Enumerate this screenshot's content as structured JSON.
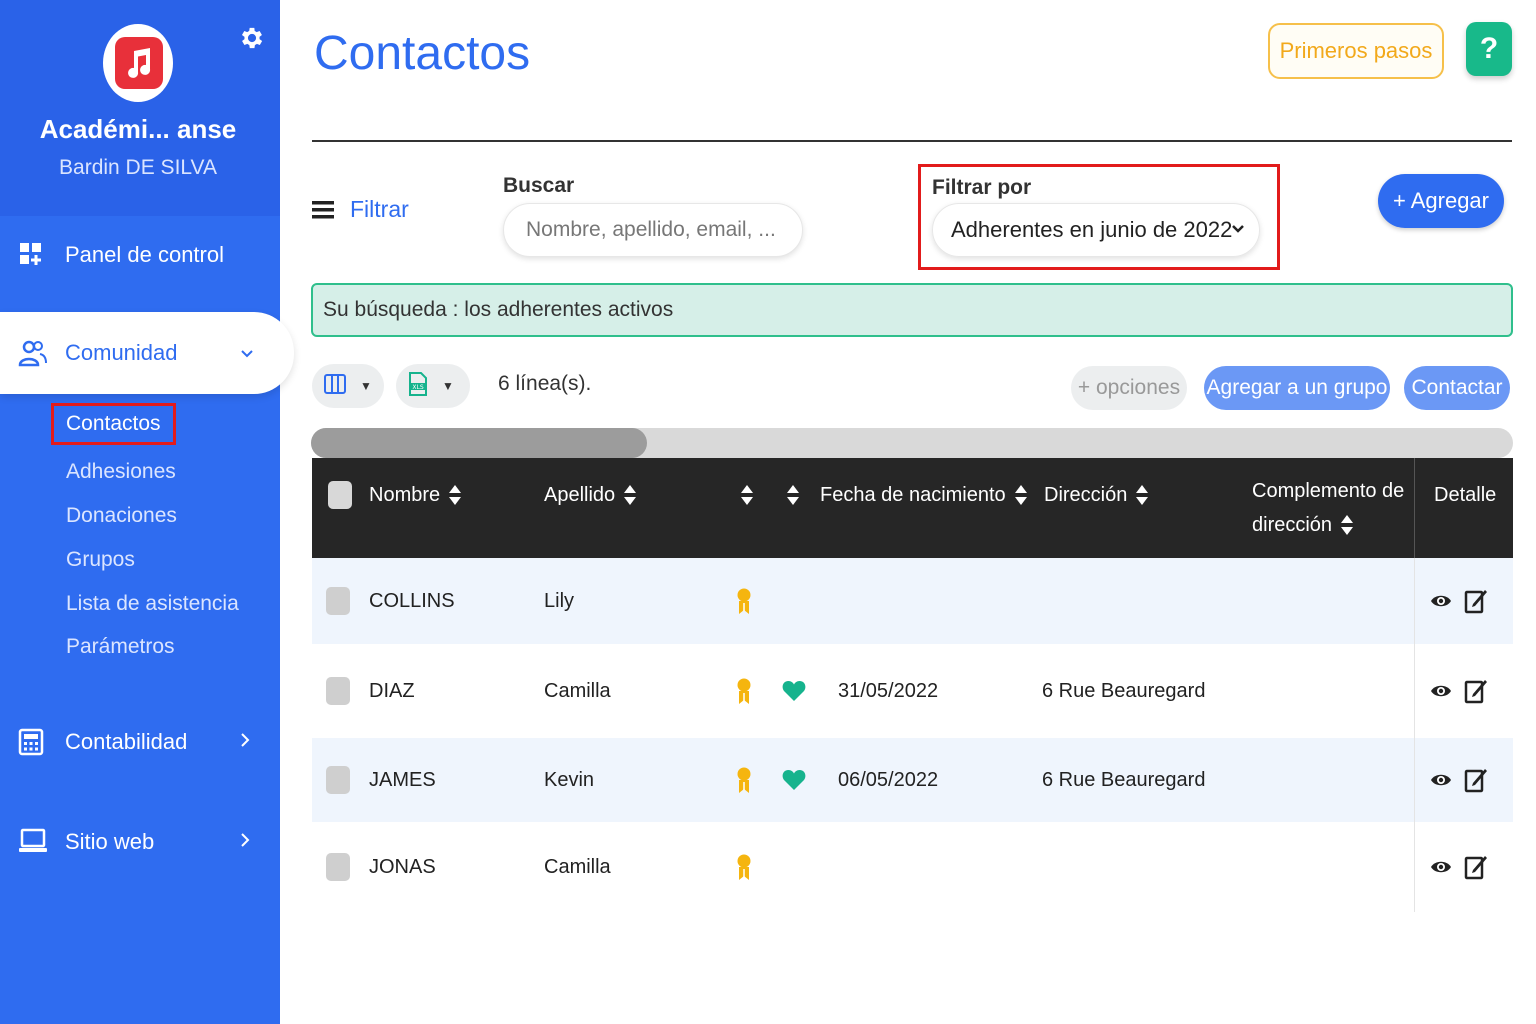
{
  "sidebar": {
    "org_name": "Académi... anse",
    "user_name": "Bardin DE SILVA",
    "nav": {
      "dashboard": "Panel de control",
      "community": "Comunidad",
      "accounting": "Contabilidad",
      "website": "Sitio web"
    },
    "community_items": [
      "Contactos",
      "Adhesiones",
      "Donaciones",
      "Grupos",
      "Lista de asistencia",
      "Parámetros"
    ]
  },
  "header": {
    "title": "Contactos",
    "primeros_pasos": "Primeros pasos",
    "help": "?"
  },
  "toolbar": {
    "filter_toggle": "Filtrar",
    "search_label": "Buscar",
    "search_placeholder": "Nombre, apellido, email, ...",
    "filter_label": "Filtrar por",
    "filter_value": "Adherentes en junio de 2022",
    "add_button": "+ Agregar"
  },
  "summary": "Su búsqueda : los adherentes activos",
  "actions": {
    "line_count": "6 línea(s).",
    "options": "+ opciones",
    "add_to_group": "Agregar a un grupo",
    "contact": "Contactar"
  },
  "table": {
    "headers": {
      "nombre": "Nombre",
      "apellido": "Apellido",
      "fecha": "Fecha de nacimiento",
      "direccion": "Dirección",
      "complemento_1": "Complemento de",
      "complemento_2": "dirección",
      "detalle": "Detalle"
    },
    "rows": [
      {
        "nombre": "COLLINS",
        "apellido": "Lily",
        "fecha": "",
        "direccion": ""
      },
      {
        "nombre": "DIAZ",
        "apellido": "Camilla",
        "fecha": "31/05/2022",
        "direccion": "6 Rue Beauregard"
      },
      {
        "nombre": "JAMES",
        "apellido": "Kevin",
        "fecha": "06/05/2022",
        "direccion": "6 Rue Beauregard"
      },
      {
        "nombre": "JONAS",
        "apellido": "Camilla",
        "fecha": "",
        "direccion": ""
      }
    ]
  },
  "colors": {
    "primary": "#2f6cf0",
    "summary_border": "#2fbf8c",
    "highlight": "#e21b1b",
    "medal": "#f5b50f",
    "heart": "#16b38d"
  }
}
